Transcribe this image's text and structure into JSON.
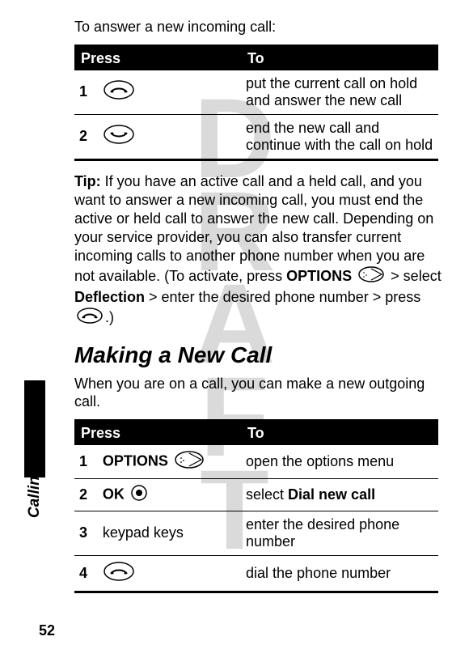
{
  "watermark": "DRAFT",
  "side_tab": "Calling Features",
  "page_number": "52",
  "intro_line": "To answer a new incoming call:",
  "table1": {
    "head_press": "Press",
    "head_to": "To",
    "rows": [
      {
        "num": "1",
        "action": "put the current call on hold and answer the new call"
      },
      {
        "num": "2",
        "action": "end the new call and continue with the call on hold"
      }
    ]
  },
  "tip": {
    "label": "Tip:",
    "part1": " If you have an active call and a held call, and you want to answer a new incoming call, you must end the active or held call to answer the new call. Depending on your service provider, you can also transfer current incoming calls to another phone number when you are not available. (To activate, press ",
    "options_word": "OPTIONS",
    "part2": " > select ",
    "deflection_word": "Deflection",
    "part3": " > enter the desired phone number > press ",
    "part4": ".)"
  },
  "section_heading": "Making a New Call",
  "section_intro": "When you are on a call, you can make a new outgoing call.",
  "table2": {
    "head_press": "Press",
    "head_to": "To",
    "rows": [
      {
        "num": "1",
        "press_label": "OPTIONS",
        "action": "open the options menu"
      },
      {
        "num": "2",
        "press_label": "OK",
        "action_prefix": "select ",
        "action_ui": "Dial new call"
      },
      {
        "num": "3",
        "press_label": "keypad keys",
        "action": "enter the desired phone number"
      },
      {
        "num": "4",
        "press_label": "",
        "action": "dial the phone number"
      }
    ]
  }
}
